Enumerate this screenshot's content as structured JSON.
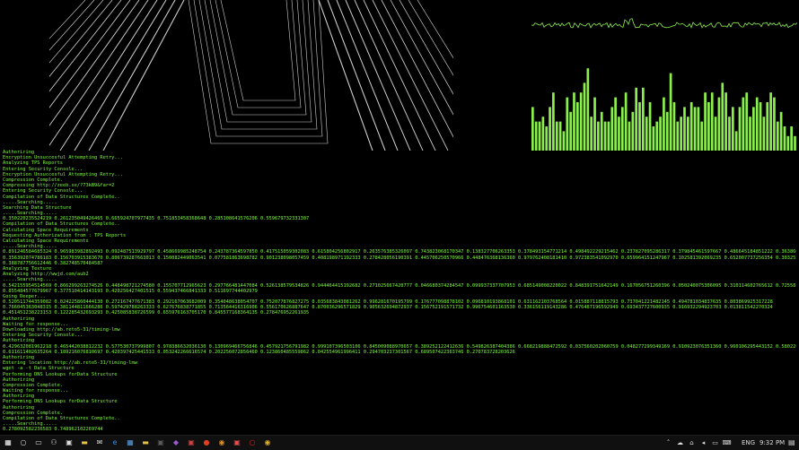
{
  "colors": {
    "terminal_text": "#7CFC3A",
    "bars": "#8CF04C",
    "wave": "#8CF04C",
    "tunnel": "#CFCFCF"
  },
  "visualizer": {
    "bar_levels": [
      0.45,
      0.3,
      0.3,
      0.35,
      0.25,
      0.45,
      0.6,
      0.3,
      0.3,
      0.2,
      0.55,
      0.4,
      0.6,
      0.5,
      0.6,
      0.7,
      0.85,
      0.35,
      0.55,
      0.3,
      0.4,
      0.3,
      0.3,
      0.45,
      0.55,
      0.35,
      0.45,
      0.6,
      0.3,
      0.4,
      0.65,
      0.5,
      0.65,
      0.35,
      0.5,
      0.25,
      0.3,
      0.35,
      0.55,
      0.4,
      0.8,
      0.5,
      0.3,
      0.35,
      0.45,
      0.35,
      0.5,
      0.45,
      0.45,
      0.3,
      0.6,
      0.5,
      0.6,
      0.35,
      0.55,
      0.7,
      0.6,
      0.35,
      0.45,
      0.2,
      0.45,
      0.55,
      0.6,
      0.35,
      0.45,
      0.55,
      0.5,
      0.35,
      0.5,
      0.6,
      0.55,
      0.3,
      0.4,
      0.25,
      0.15,
      0.25,
      0.15
    ]
  },
  "terminal": {
    "lines": [
      "Authoriring",
      "Encryption Unsuccesful Attempting Retry...",
      "Analyzing TPS Reports",
      "Entering Security Console...",
      "Encryption Unsuccesful Attempting Retry...",
      "Compression Complete.",
      "Compressing http://zeeb.se/?73kB9&far=2",
      "Entering Security Console...",
      "Compilation of Data Structures Complete..",
      ".....Searching.....",
      "Searching Data Structure",
      ".....Searching.....",
      "0.350220235524219 0.261235049426465 0.665924707977435 0.751853458368648 0.285108641576206 0.559679732331307",
      "Compilation of Data Structures Complete..",
      "Calculating Space Requirements",
      "Requesting Authorization from : TPS Reports",
      "Calculating Space Requirements",
      ".....Searching.....",
      "0.891246584685324 0.965983982892493 0.092487513929797 0.458669985248754 0.243787364597850 0.417515059302083 0.615804256802917 0.263576385326097 0.743823068170347 0.138327706263353 0.378493154771214 0.498492229215462 0.237827095286317 0.379845461597667 0.486645184851222 0.363860551352434",
      "0.356392074786183 0.156703915383670 0.806739287663013 0.150082449063541 0.077581863698782 0.901238098057459 0.408198971192333 0.278428056190391 0.445706250570966 0.448476368136360 0.979762408181410 0.972383541092970 0.659964151247967 0.102581392069235 0.652007737256354 0.303255471235589",
      "0.388787756612446 0.382748570484587",
      "Analyzing Texture",
      "Analyzing http://wwjd.com/aub2",
      ".....Searching.....",
      "0.542155954514569 0.866299263274526 0.448498721274580 0.155707712965623 0.297766481447084 0.526138579534826 0.944464415192682 0.271025667420777 0.046680374284547 0.099937337707953 0.685149008220022 0.848391751642149 0.167056751260396 0.050240075306095 0.310114602765612 0.725581560542856",
      "0.855484577679967 0.377510414143193 0.420256427401515 0.559437466841333 0.511697744402979",
      "Going Deeper...",
      "0.520511744359082 0.024225860444130 0.272167477671383 0.292167063682009 0.354048638054707 0.752077876827275 0.035683843081262 0.996281670195799 0.176777098878102 0.096810193868101 0.631162103768564 0.015887118815793 0.737041221482145 0.494781034837635 0.803869925317228",
      "0.766045363048315 0.381144811666286 0.597429788263333 0.627676838771855 0.713564416316906 0.556170626887647 0.870036296571829 0.905632694872937 0.156752191571732 0.996754601163530 0.336156119143286 0.476487196592949 0.693437727600935 0.916932294923703 0.013811542270324",
      "0.451451238223153 0.122285432693293 0.425085838726599 0.655976163705170 0.845577168364135 0.278476952261935",
      "Authoriring",
      "Waiting for response...",
      "Downloading http://ab.reto5-31/timing-lmw",
      "Entering Security Console...",
      "Authoriring",
      "0.429632081962218 0.465442038812232 0.577530737999807 0.978386632036130 0.130969466756846 0.457921756791982 0.999107396503106 0.845009088970657 0.389252122412636 0.549826387404386 0.668219888472592 0.037560202060759 0.048277299349169 0.910923076351360 0.960106295443152 0.580220283741523",
      "0.611611402635264 0.189216076810697 0.420397425441533 0.053242266616574 0.202256072856460 0.123860485559862 0.042554961996411 0.294703237301567 0.689507422363746 0.270783728203626",
      "Authoriring",
      "Entering location http://ab.reto5-31/timing-lmw",
      "wget -a -t Data Structure",
      "Performing DNS Lookups forData Structure",
      "Authoriring",
      "Compression Complete.",
      "Waiting for response...",
      "Authoriring",
      "Performing DNS Lookups forData Structure",
      "Authoriring",
      "Compression Complete.",
      "Compilation of Data Structures Complete..",
      ".....Searching.....",
      "0.278092582236583 0.748962102269744"
    ]
  },
  "taskbar": {
    "icons": [
      {
        "name": "windows-start-icon",
        "glyph": "▦",
        "color": "#ffffff"
      },
      {
        "name": "search-icon",
        "glyph": "○",
        "color": "#dddddd"
      },
      {
        "name": "task-view-icon",
        "glyph": "▭",
        "color": "#dddddd"
      },
      {
        "name": "people-icon",
        "glyph": "⚇",
        "color": "#dddddd"
      },
      {
        "name": "store-icon",
        "glyph": "▣",
        "color": "#dddddd"
      },
      {
        "name": "file-explorer-icon",
        "glyph": "▬",
        "color": "#e8c245"
      },
      {
        "name": "mail-icon",
        "glyph": "✉",
        "color": "#dddddd"
      },
      {
        "name": "edge-icon",
        "glyph": "e",
        "color": "#3d8fe0"
      },
      {
        "name": "photos-icon",
        "glyph": "▦",
        "color": "#5aa0e0"
      },
      {
        "name": "folder-icon",
        "glyph": "▬",
        "color": "#e8c245"
      },
      {
        "name": "terminal-icon",
        "glyph": "▣",
        "color": "#5a5a5a"
      },
      {
        "name": "visual-studio-icon",
        "glyph": "◆",
        "color": "#9b59d0"
      },
      {
        "name": "app-icon",
        "glyph": "▣",
        "color": "#d04040"
      },
      {
        "name": "app-icon-2",
        "glyph": "●",
        "color": "#e04020"
      },
      {
        "name": "app-icon-3",
        "glyph": "◉",
        "color": "#e09020"
      },
      {
        "name": "app-icon-4",
        "glyph": "▣",
        "color": "#e05050"
      },
      {
        "name": "opera-icon",
        "glyph": "○",
        "color": "#e02020"
      },
      {
        "name": "chrome-icon",
        "glyph": "◉",
        "color": "#e0b020"
      }
    ],
    "tray": {
      "icons": [
        "chevron-up-icon",
        "cloud-icon",
        "network-icon",
        "volume-icon",
        "battery-icon",
        "keyboard-icon"
      ],
      "glyphs": [
        "˄",
        "☁",
        "⌂",
        "◂",
        "▭",
        "⌨"
      ],
      "language": "ENG",
      "time": "9:32 PM",
      "notifications_glyph": "▤"
    }
  }
}
